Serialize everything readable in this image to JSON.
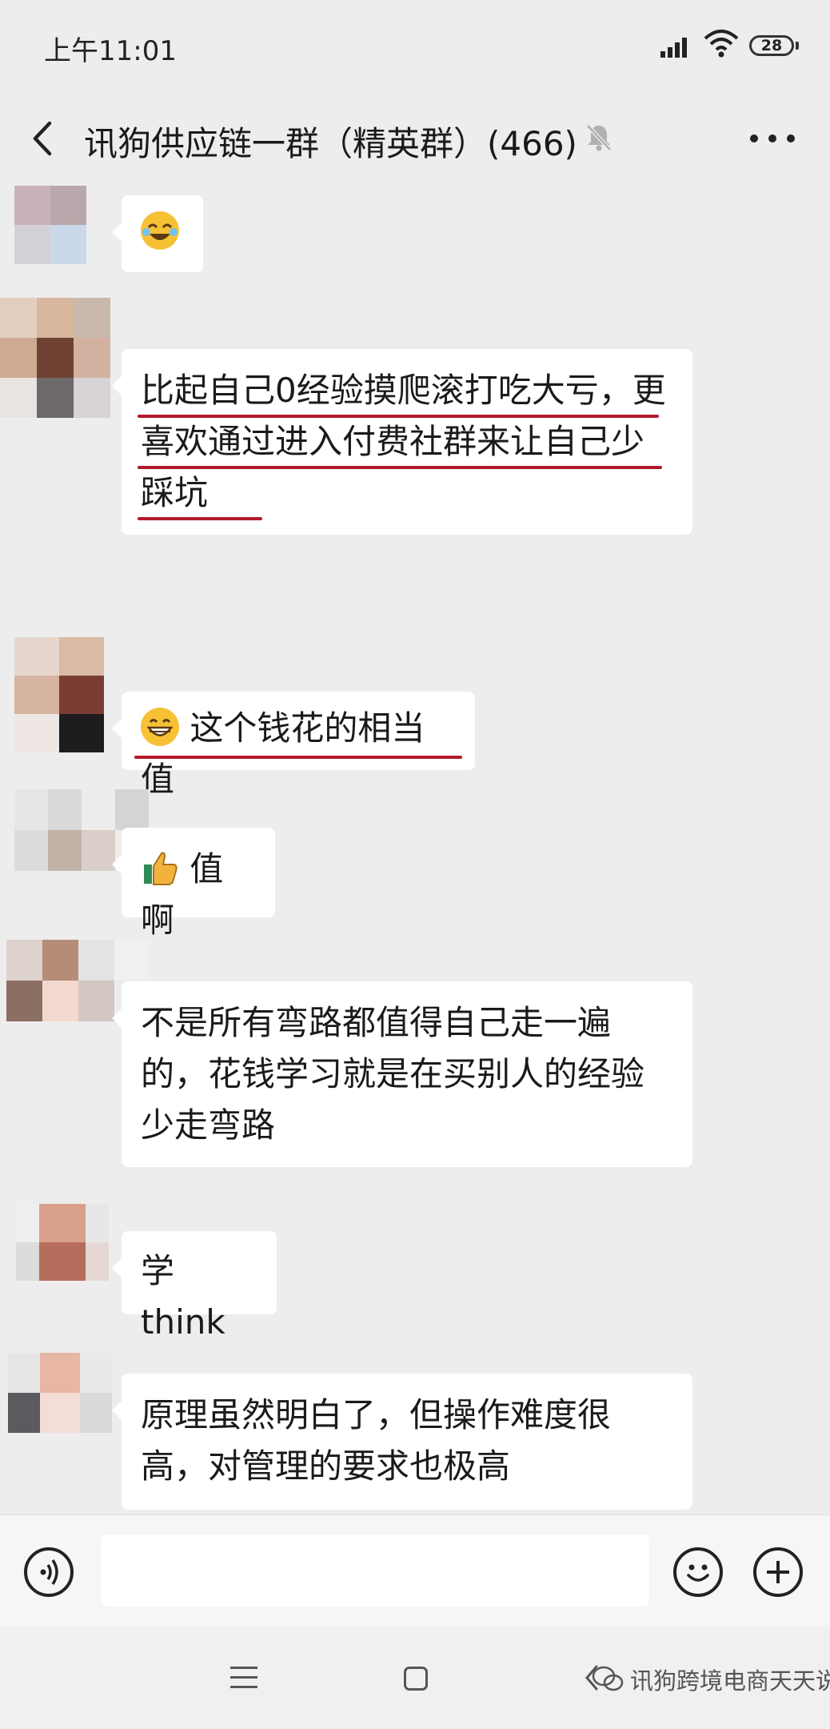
{
  "status_bar": {
    "time": "上午11:01",
    "battery": "28"
  },
  "header": {
    "title": "讯狗供应链一群（精英群）(466)"
  },
  "messages": [
    {
      "text": ""
    },
    {
      "text": "比起自己0经验摸爬滚打吃大亏，更喜欢通过进入付费社群来让自己少踩坑"
    },
    {
      "text": "这个钱花的相当值"
    },
    {
      "text": "值啊"
    },
    {
      "text": "不是所有弯路都值得自己走一遍的，花钱学习就是在买别人的经验 少走弯路"
    },
    {
      "text": "学 think"
    },
    {
      "text": "原理虽然明白了，但操作难度很高，对管理的要求也极高"
    }
  ],
  "input": {
    "value": ""
  },
  "watermark": {
    "text": "讯狗跨境电商天天说"
  },
  "colors": {
    "background": "#ededed",
    "bubble": "#ffffff",
    "underline": "#b2182b"
  }
}
